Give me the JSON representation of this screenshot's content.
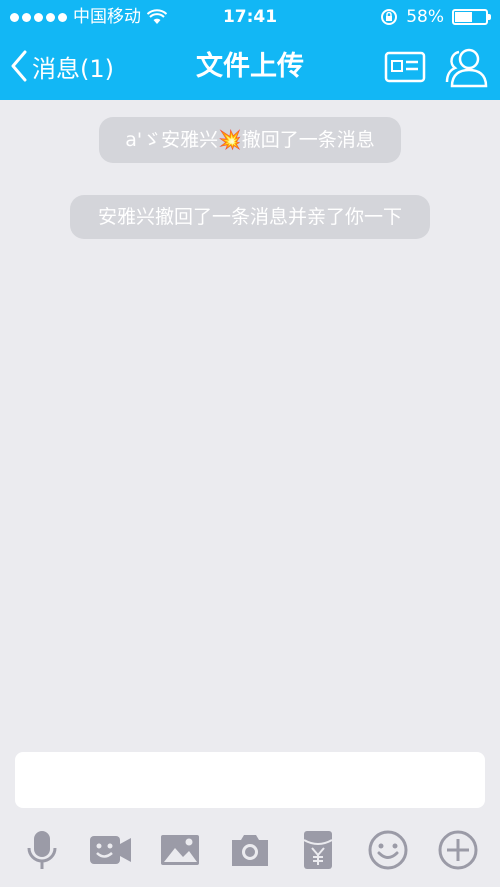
{
  "status_bar": {
    "carrier": "中国移动",
    "time": "17:41",
    "battery_percent": "58%",
    "battery_level": 0.58
  },
  "nav": {
    "back_label": "消息(1)",
    "title": "文件上传"
  },
  "messages": [
    {
      "prefix": "a'ゞ安雅兴",
      "emoji": "💥",
      "suffix": "撤回了一条消息"
    },
    {
      "text": "安雅兴撤回了一条消息并亲了你一下"
    }
  ],
  "input": {
    "value": ""
  },
  "toolbar_icons": [
    "microphone-icon",
    "video-chat-icon",
    "image-icon",
    "camera-icon",
    "red-packet-icon",
    "emoji-icon",
    "plus-icon"
  ],
  "colors": {
    "accent": "#12b7f5",
    "background": "#ebebef",
    "icon_gray": "#9b9ba7"
  }
}
